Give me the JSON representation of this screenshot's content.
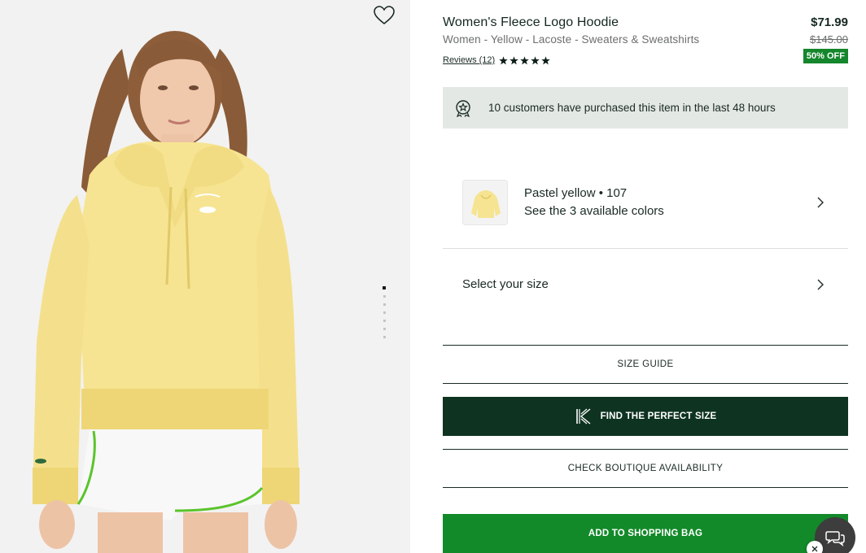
{
  "product": {
    "title": "Women's Fleece Logo Hoodie",
    "subtitle": "Women - Yellow - Lacoste - Sweaters & Sweatshirts",
    "reviews_label": "Reviews (12)",
    "rating_stars": 5,
    "price": "$71.99",
    "original_price": "$145.00",
    "discount_label": "50% OFF"
  },
  "social_proof": {
    "text": "10 customers have purchased this item in the last 48 hours",
    "icon": "badge-star-icon"
  },
  "color_selector": {
    "name": "Pastel yellow • 107",
    "available": "See the 3 available colors"
  },
  "size_selector": {
    "label": "Select your size"
  },
  "buttons": {
    "size_guide": "SIZE GUIDE",
    "find_perfect_size": "FIND THE PERFECT SIZE",
    "boutique_availability": "CHECK BOUTIQUE AVAILABILITY",
    "add_to_bag": "ADD TO SHOPPING BAG"
  },
  "gallery": {
    "image_count": 7,
    "active_index": 0
  },
  "colors": {
    "dark_green": "#0e3321",
    "bright_green": "#138a2a",
    "discount_green": "#14862b",
    "notice_bg": "#e3e8e5",
    "hoodie_yellow": "#f6e492"
  }
}
